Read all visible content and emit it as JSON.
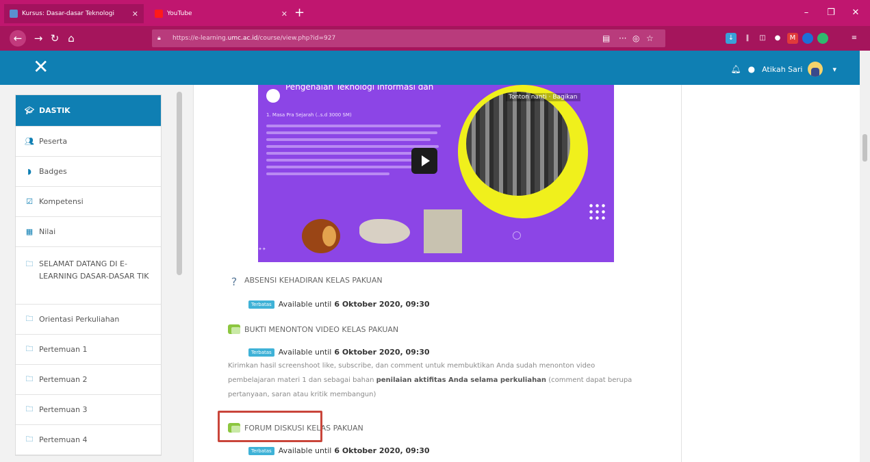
{
  "browser": {
    "tabs": [
      {
        "title": "Kursus: Dasar-dasar Teknologi",
        "active": true
      },
      {
        "title": "YouTube",
        "active": false
      }
    ],
    "url_prefix": "https://e-learning.",
    "url_domain": "umc.ac.id",
    "url_path": "/course/view.php?id=927"
  },
  "header": {
    "user_name": "Atikah Sari"
  },
  "sidebar": {
    "items": [
      {
        "label": "DASTIK"
      },
      {
        "label": "Peserta"
      },
      {
        "label": "Badges"
      },
      {
        "label": "Kompetensi"
      },
      {
        "label": "Nilai"
      },
      {
        "label": "SELAMAT DATANG DI E-LEARNING DASAR-DASAR TIK"
      },
      {
        "label": "Orientasi Perkuliahan"
      },
      {
        "label": "Pertemuan 1"
      },
      {
        "label": "Pertemuan 2"
      },
      {
        "label": "Pertemuan 3"
      },
      {
        "label": "Pertemuan 4"
      }
    ]
  },
  "video": {
    "title": "Pengenalan Teknologi Informasi dan",
    "watch_later": "Tonton nanti · Bagikan",
    "list_item": "1. Masa Pra Sejarah (..s.d 3000 SM)"
  },
  "activities": [
    {
      "name": "ABSENSI KEHADIRAN KELAS PAKUAN",
      "restriction": "Terbatas",
      "available_text": "Available until",
      "available_date": "6 Oktober 2020, 09:30"
    },
    {
      "name": "BUKTI MENONTON VIDEO KELAS PAKUAN",
      "restriction": "Terbatas",
      "available_text": "Available until",
      "available_date": "6 Oktober 2020, 09:30"
    },
    {
      "name": "FORUM DISKUSI KELAS PAKUAN",
      "restriction": "Terbatas",
      "available_text": "Available until",
      "available_date": "6 Oktober 2020, 09:30"
    }
  ],
  "description": {
    "part1": "Kirimkan hasil screenshoot like, subscribe, dan comment untuk membuktikan Anda sudah menonton video pembelajaran materi 1 dan sebagai bahan ",
    "bold1": "penilaian aktifitas Anda selama perkuliahan",
    "part2": " (comment dapat berupa pertanyaan, saran atau kritik membangun)"
  },
  "colors": {
    "browser_accent": "#c0166f",
    "moodle_header": "#0f7fb3",
    "video_bg": "#8c45e6",
    "highlight_border": "#c9453a"
  }
}
